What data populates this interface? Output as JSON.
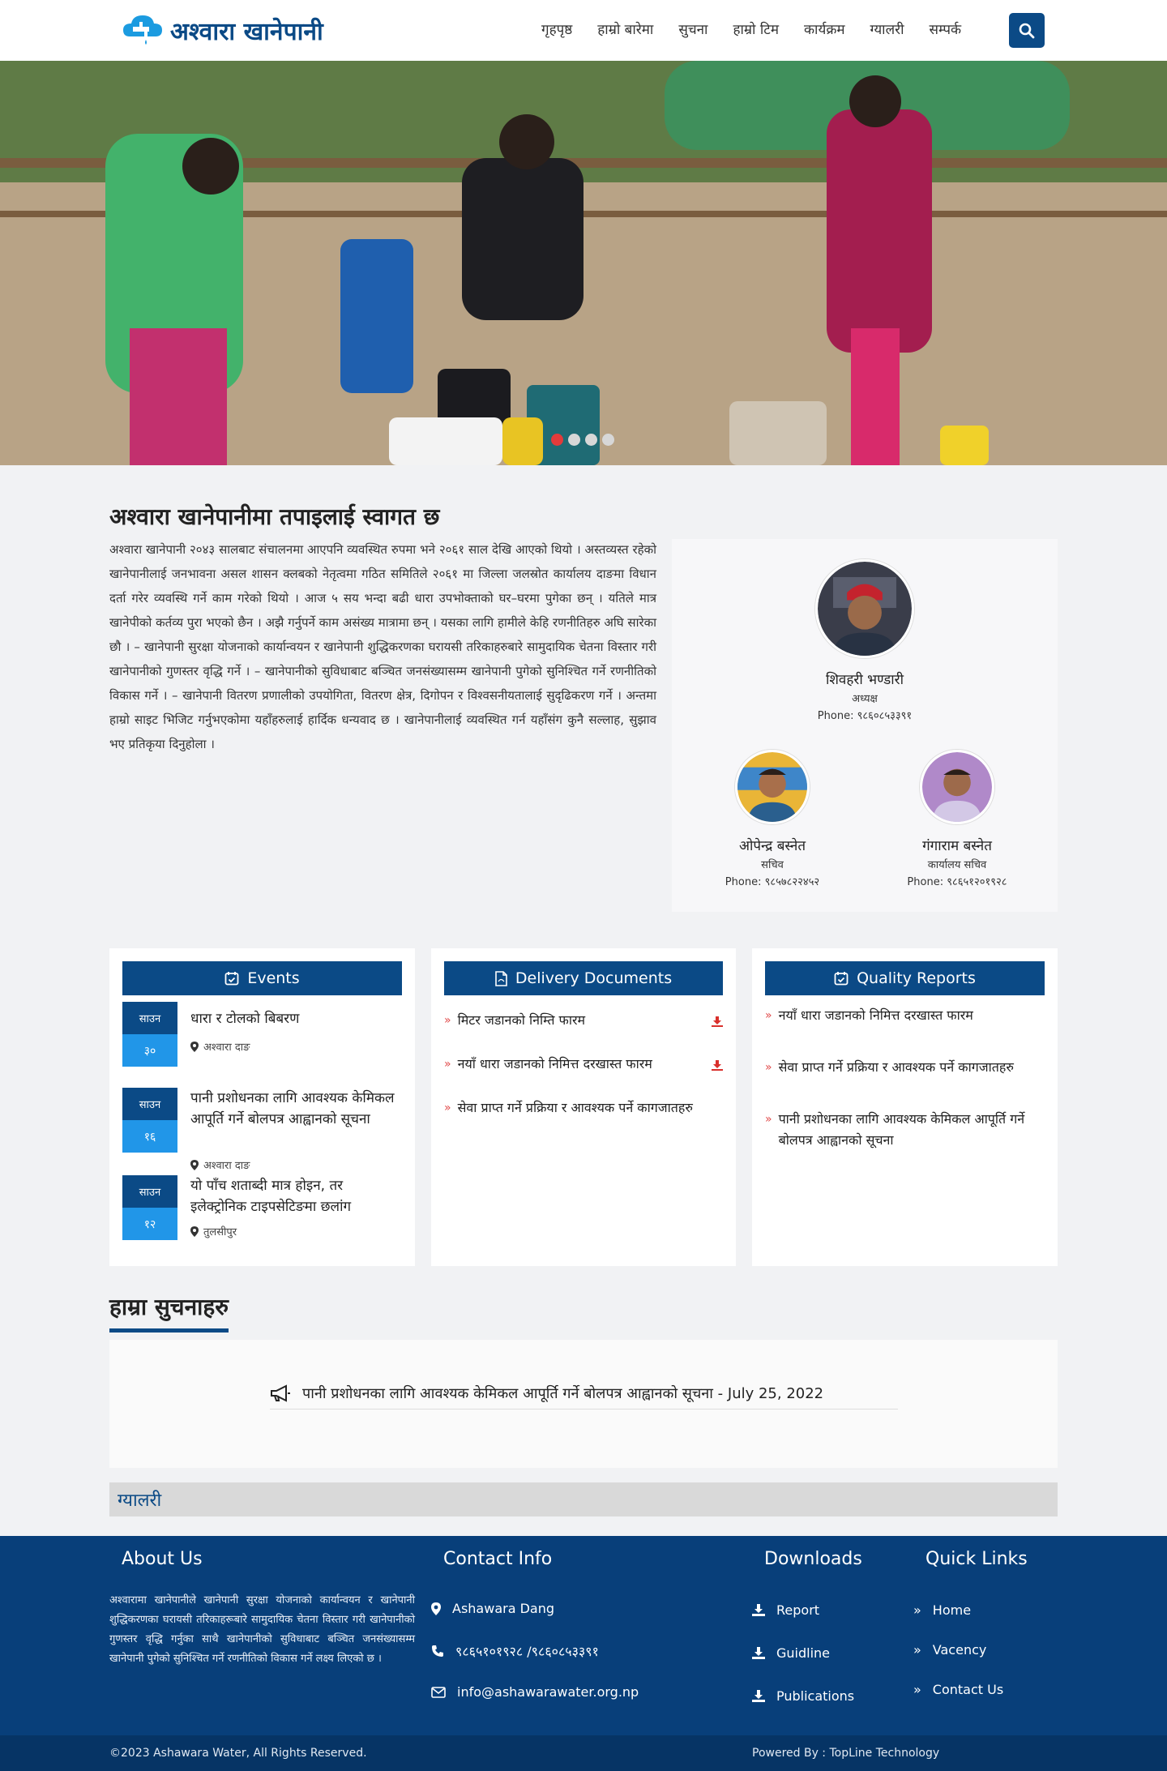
{
  "nav": {
    "logo_text": "अश्वारा खानेपानी",
    "items": [
      "गृहपृष्ठ",
      "हाम्रो बारेमा",
      "सुचना",
      "हाम्रो टिम",
      "कार्यक्रम",
      "ग्यालरी",
      "सम्पर्क"
    ]
  },
  "welcome": {
    "title": "अश्वारा खानेपानीमा तपाइलाई स्वागत छ",
    "body": "अश्वारा खानेपानी २०४३ सालबाट संचालनमा आएपनि व्यवस्थित रुपमा भने २०६१ साल देखि आएको थियो । अस्तव्यस्त रहेको खानेपानीलाई जनभावना असल शासन क्लबको नेतृत्वमा गठित समितिले २०६१ मा जिल्ला जलस्रोत कार्यालय दाङमा विधान दर्ता गरेर व्यवस्थि गर्ने काम गरेको थियो । आज ५ सय भन्दा बढी धारा उपभोक्ताको घर–घरमा पुगेका छन् । यतिले मात्र खानेपीको कर्तव्य पुरा भएको छैन । अझै गर्नुपर्ने काम असंख्य मात्रामा छन् । यसका लागि हामीले केहि रणनीतिहरु अघि सारेका छौ । – खानेपानी सुरक्षा योजनाको कार्यान्वयन र खानेपानी शुद्धिकरणका घरायसी तरिकाहरुबारे सामुदायिक चेतना विस्तार गरी खानेपानीको गुणस्तर वृद्धि गर्ने । – खानेपानीको सुविधाबाट बञ्चित जनसंख्यासम्म खानेपानी पुगेको सुनिश्चित गर्ने रणनीतिको विकास गर्ने । – खानेपानी वितरण प्रणालीको उपयोगिता, वितरण क्षेत्र, दिगोपन र विश्वसनीयतालाई सुदृढिकरण गर्ने । अन्तमा हाम्रो साइट भिजिट गर्नुभएकोमा यहाँहरुलाई हार्दिक धन्यवाद छ । खानेपानीलाई व्यवस्थित गर्न यहाँसंग कुनै सल्लाह, सुझाव भए प्रतिकृया दिनुहोला ।"
  },
  "team": [
    {
      "name": "शिवहरी भण्डारी",
      "role": "अध्यक्ष",
      "phone": "Phone: ९८६०८५३३९१"
    },
    {
      "name": "ओपेन्द्र बस्नेत",
      "role": "सचिव",
      "phone": "Phone: ९८५७८२२४५२"
    },
    {
      "name": "गंगाराम बस्नेत",
      "role": "कार्यालय सचिव",
      "phone": "Phone: ९८६५१२०१९२८"
    }
  ],
  "events": {
    "title": "Events",
    "items": [
      {
        "month": "साउन",
        "day": "३०",
        "title": "धारा र टोलको बिबरण",
        "location": "अश्वारा दाङ"
      },
      {
        "month": "साउन",
        "day": "१६",
        "title": "पानी प्रशोधनका लागि आवश्यक केमिकल आपूर्ति गर्ने बोलपत्र आह्वानको सूचना",
        "location": "अश्वारा दाङ"
      },
      {
        "month": "साउन",
        "day": "१२",
        "title": "यो पाँच शताब्दी मात्र होइन, तर इलेक्ट्रोनिक टाइपसेटिङमा छलांग",
        "location": "तुलसीपुर"
      }
    ]
  },
  "delivery": {
    "title": "Delivery Documents",
    "items": [
      "मिटर जडानको निम्ति फारम",
      "नयाँ धारा जडानको निमित्त दरखास्त फारम",
      "सेवा प्राप्त गर्ने प्रक्रिया र आवश्यक पर्ने कागजातहरु"
    ]
  },
  "quality": {
    "title": "Quality Reports",
    "items": [
      "नयाँ धारा जडानको निमित्त दरखास्त फारम",
      "सेवा प्राप्त गर्ने प्रक्रिया र आवश्यक पर्ने कागजातहरु",
      "पानी प्रशोधनका लागि आवश्यक केमिकल आपूर्ति गर्ने बोलपत्र आह्वानको सूचना"
    ]
  },
  "notices": {
    "heading": "हाम्रा सुचनाहरु",
    "item": "पानी प्रशोधनका लागि आवश्यक केमिकल आपूर्ति गर्ने बोलपत्र आह्वानको सूचना - July 25, 2022"
  },
  "gallery": {
    "heading": "ग्यालरी"
  },
  "footer": {
    "about_title": "About Us",
    "about_text": "अश्वारामा खानेपानीले खानेपानी सुरक्षा योजनाको कार्यान्वयन र खानेपानी शुद्धिकरणका घरायसी तरिकाहरूबारे सामुदायिक चेतना विस्तार गरी खानेपानीको गुणस्तर वृद्धि गर्नुका साथै खानेपानीको सुविधाबाट बञ्चित जनसंख्यासम्म खानेपानी पुगेको सुनिश्चित गर्ने रणनीतिको विकास गर्ने लक्ष्य लिएको छ ।",
    "contact_title": "Contact Info",
    "contact": {
      "address": "Ashawara Dang",
      "phone": "९८६५१०१९२८ /९८६०८५३३९१",
      "email": "info@ashawarawater.org.np"
    },
    "downloads_title": "Downloads",
    "downloads": [
      "Report",
      "Guidline",
      "Publications"
    ],
    "quick_title": "Quick Links",
    "quick": [
      "Home",
      "Vacency",
      "Contact Us"
    ]
  },
  "copyright": {
    "left": "©2023 Ashawara Water, All Rights Reserved.",
    "right": "Powered By : TopLine Technology"
  },
  "colors": {
    "primary": "#0b4a86",
    "accent": "#e14a4a",
    "date_day": "#2196e8"
  }
}
